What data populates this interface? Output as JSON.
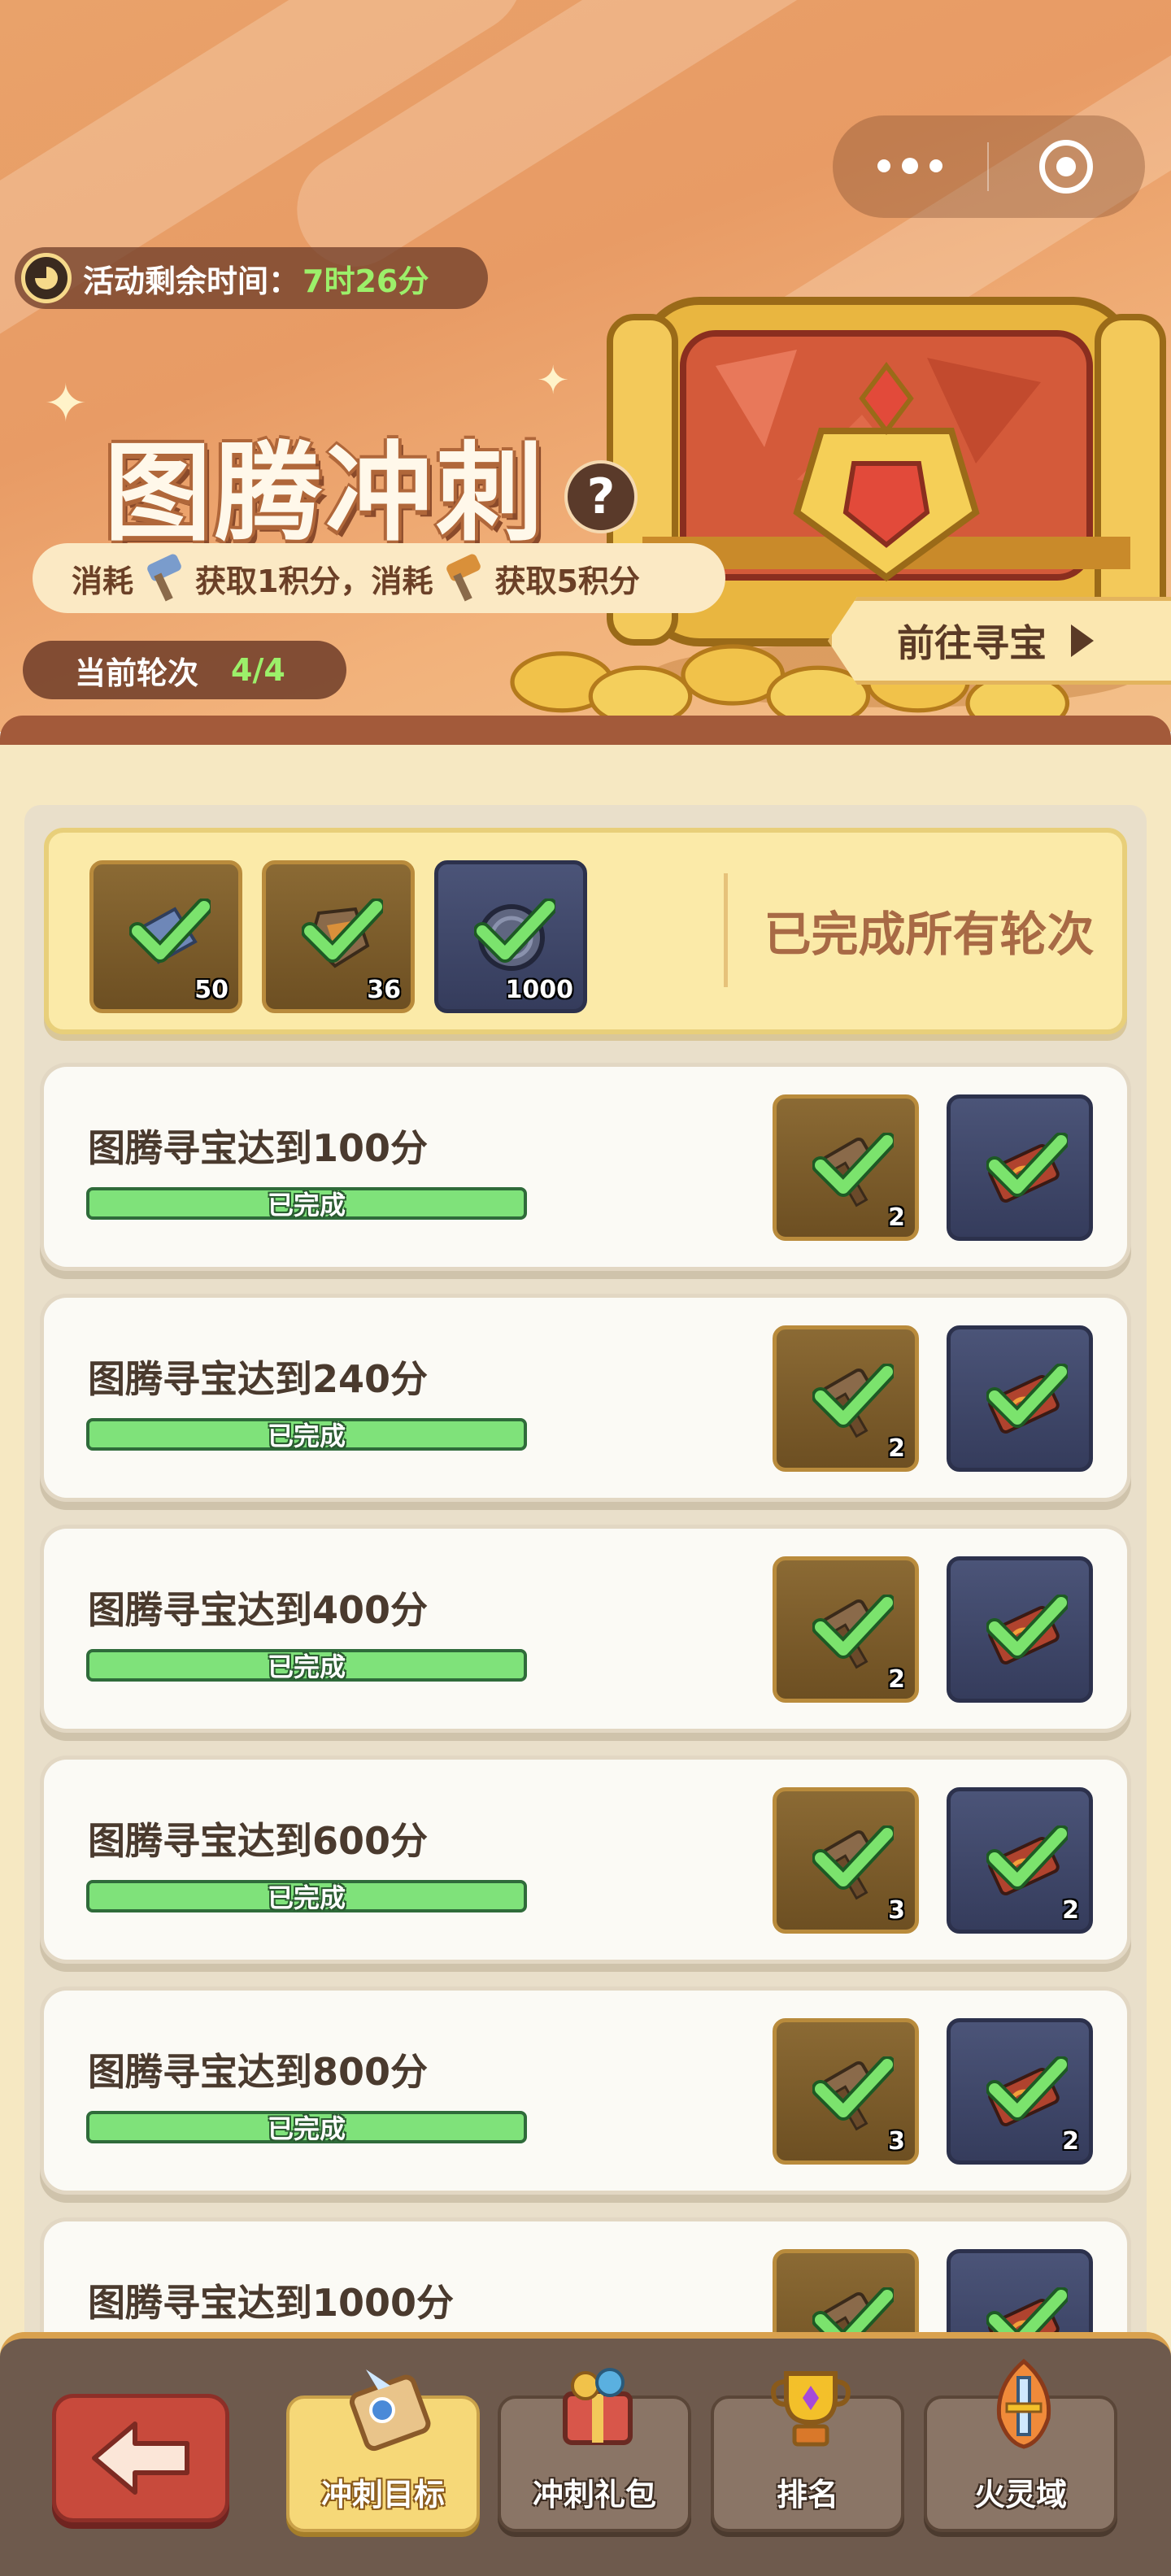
{
  "header": {
    "timer_label": "活动剩余时间：",
    "timer_value": "7时26分",
    "title": "图腾冲刺",
    "consume": {
      "part1": "消耗",
      "part2": "获取1积分，消耗",
      "part3": "获取5积分"
    },
    "round_label": "当前轮次",
    "round_value": "4/4",
    "goto_label": "前往寻宝"
  },
  "summary": {
    "rewards": [
      {
        "icon": "blue-hammer-icon",
        "qty": "50"
      },
      {
        "icon": "gold-hammer-icon",
        "qty": "36"
      },
      {
        "icon": "coin-icon",
        "qty": "1000"
      }
    ],
    "status": "已完成所有轮次"
  },
  "tasks": [
    {
      "name": "图腾寻宝达到100分",
      "status": "已完成",
      "reward1_qty": "2",
      "reward2_qty": ""
    },
    {
      "name": "图腾寻宝达到240分",
      "status": "已完成",
      "reward1_qty": "2",
      "reward2_qty": ""
    },
    {
      "name": "图腾寻宝达到400分",
      "status": "已完成",
      "reward1_qty": "2",
      "reward2_qty": ""
    },
    {
      "name": "图腾寻宝达到600分",
      "status": "已完成",
      "reward1_qty": "3",
      "reward2_qty": "2"
    },
    {
      "name": "图腾寻宝达到800分",
      "status": "已完成",
      "reward1_qty": "3",
      "reward2_qty": "2"
    },
    {
      "name": "图腾寻宝达到1000分",
      "status": "",
      "reward1_qty": "",
      "reward2_qty": ""
    }
  ],
  "footer": {
    "tabs": [
      {
        "label": "冲刺目标",
        "icon": "scroll-icon",
        "active": true
      },
      {
        "label": "冲刺礼包",
        "icon": "gift-icon",
        "active": false
      },
      {
        "label": "排名",
        "icon": "trophy-icon",
        "active": false
      },
      {
        "label": "火灵域",
        "icon": "sword-icon",
        "active": false
      }
    ]
  },
  "colors": {
    "accent_green": "#9cf06a",
    "progress_green": "#7fe27a",
    "header_orange": "#e89b65",
    "back_red": "#c84a3c"
  }
}
